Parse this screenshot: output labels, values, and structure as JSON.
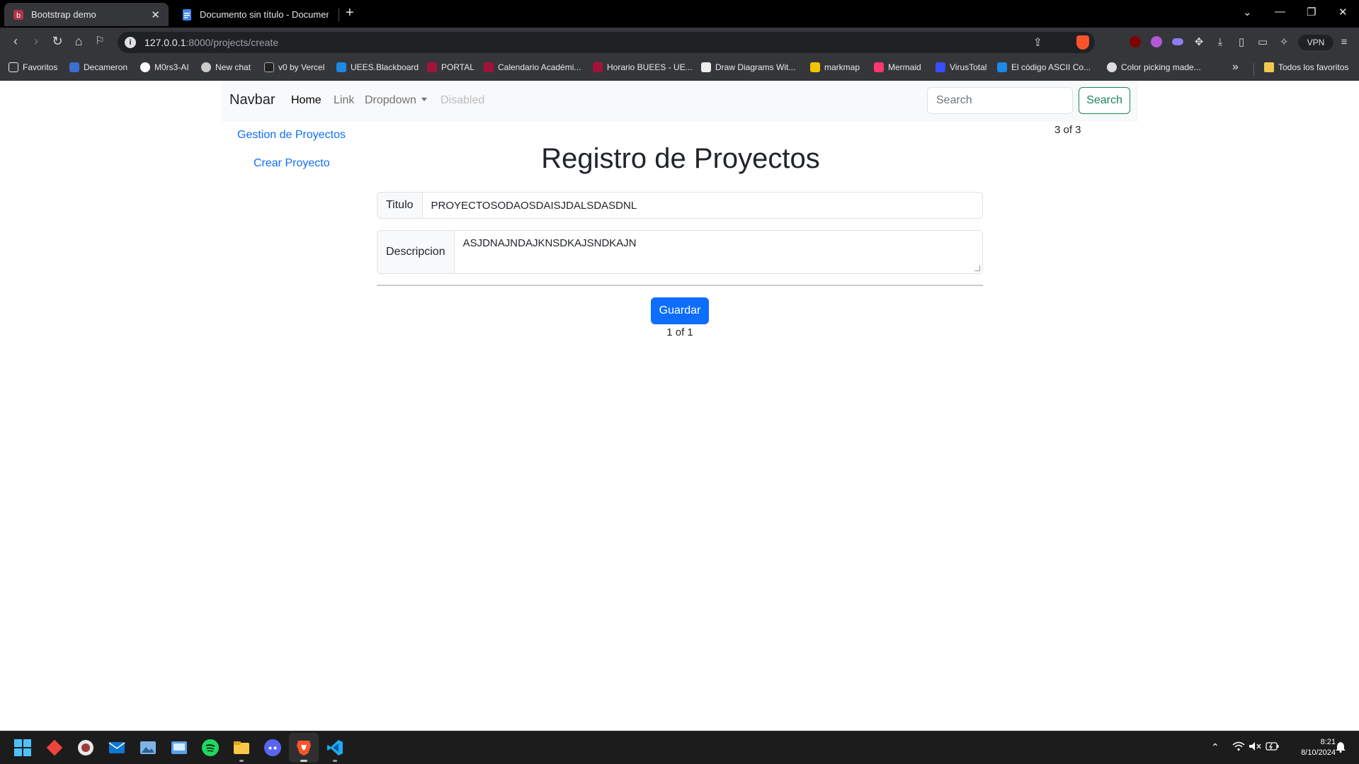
{
  "browser": {
    "tabs": [
      {
        "title": "Bootstrap demo",
        "active": true
      },
      {
        "title": "Documento sin título - Documentos",
        "active": false
      }
    ],
    "url_host": "127.0.0.1",
    "url_path": ":8000/projects/create",
    "vpn_label": "VPN",
    "bookmarks": [
      {
        "label": "Favoritos",
        "color": "#e8eaed"
      },
      {
        "label": "Decameron",
        "color": "#3b6fd1"
      },
      {
        "label": "M0rs3-AI",
        "color": "#ffffff"
      },
      {
        "label": "New chat",
        "color": "#cccccc"
      },
      {
        "label": "v0 by Vercel",
        "color": "#222222"
      },
      {
        "label": "UEES.Blackboard",
        "color": "#1e88e5"
      },
      {
        "label": "PORTAL",
        "color": "#a3123a"
      },
      {
        "label": "Calendario Académi...",
        "color": "#a3123a"
      },
      {
        "label": "Horario BUEES - UE...",
        "color": "#a3123a"
      },
      {
        "label": "Draw Diagrams Wit...",
        "color": "#eeeeee"
      },
      {
        "label": "markmap",
        "color": "#f5c400"
      },
      {
        "label": "Mermaid",
        "color": "#ff3670"
      },
      {
        "label": "VirusTotal",
        "color": "#394eff"
      },
      {
        "label": "El código ASCII Co...",
        "color": "#1e88e5"
      },
      {
        "label": "Color picking made...",
        "color": "#dddddd"
      }
    ],
    "bookmarks_folder": "Todos los favoritos"
  },
  "navbar": {
    "brand": "Navbar",
    "links": {
      "home": "Home",
      "link": "Link",
      "dropdown": "Dropdown",
      "disabled": "Disabled"
    },
    "search_placeholder": "Search",
    "search_button": "Search"
  },
  "sidebar": {
    "items": [
      "Gestion de Proyectos",
      "Crear Proyecto"
    ]
  },
  "counters": {
    "top": "3 of 3",
    "bottom": "1 of 1"
  },
  "form": {
    "title": "Registro de Proyectos",
    "titulo_label": "Titulo",
    "titulo_value": "PROYECTOSODAOSDAISJDALSDASDNL",
    "descripcion_label": "Descripcion",
    "descripcion_value": "ASJDNAJNDAJKNSDKAJSNDKAJN",
    "submit_label": "Guardar"
  },
  "taskbar": {
    "time": "8:21",
    "date": "8/10/2024"
  },
  "colors": {
    "primary": "#0d6efd",
    "success": "#198754",
    "navbar_bg": "#f8f9fa"
  }
}
